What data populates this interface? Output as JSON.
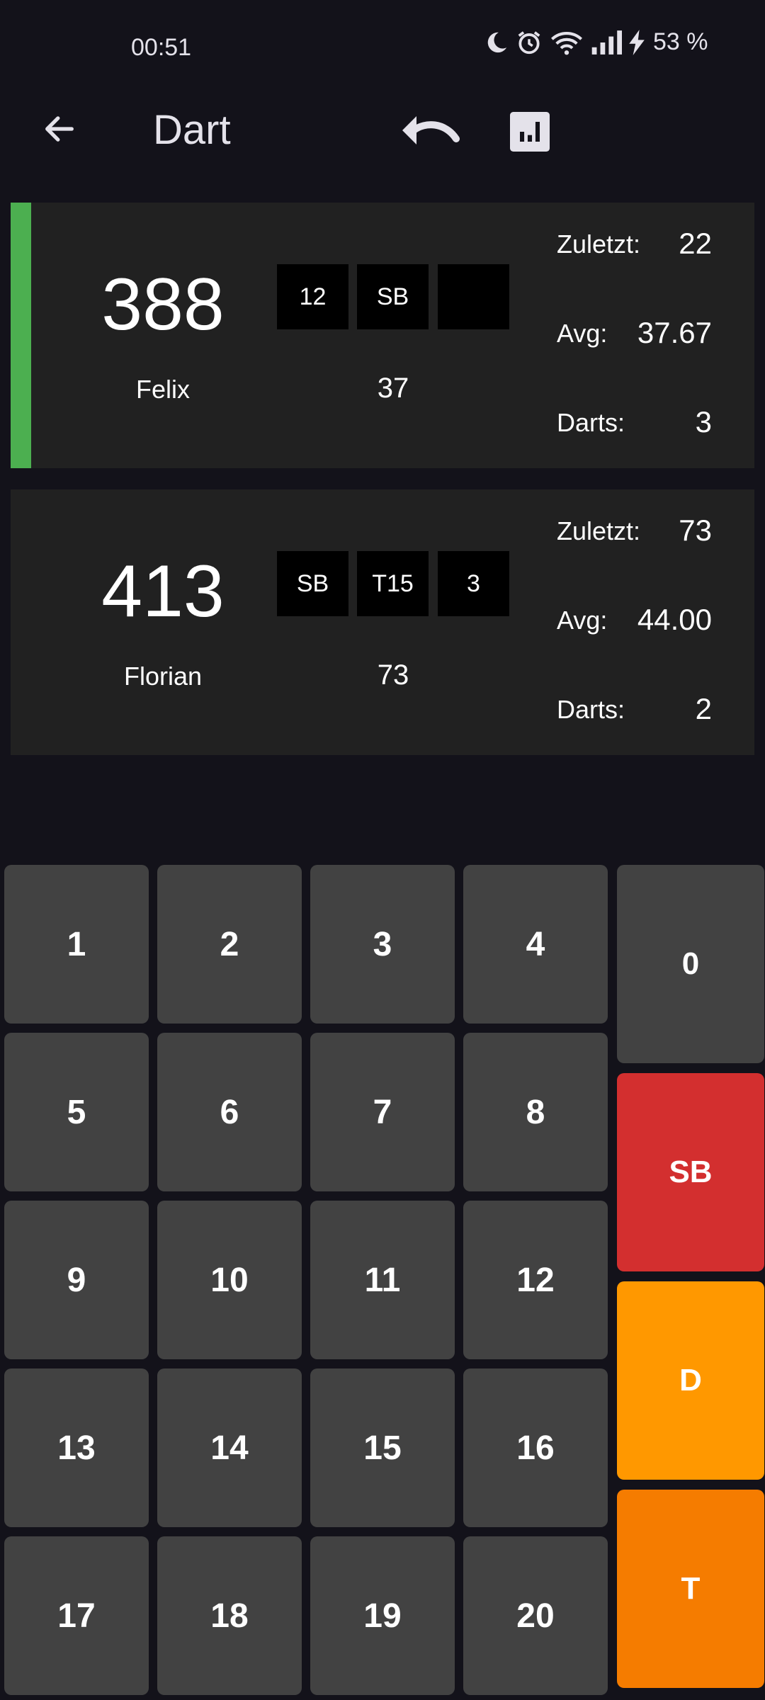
{
  "status_bar": {
    "time": "00:51",
    "battery": "53 %",
    "icons": [
      "moon-icon",
      "alarm-icon",
      "wifi-icon",
      "signal-icon",
      "charging-icon"
    ]
  },
  "app_bar": {
    "title": "Dart",
    "back_icon": "arrow-left-icon",
    "undo_icon": "undo-icon",
    "stats_icon": "bar-chart-icon"
  },
  "players": [
    {
      "name": "Felix",
      "score": "388",
      "throws": [
        "12",
        "SB",
        ""
      ],
      "round_total": "37",
      "active": true,
      "stats": {
        "last_label": "Zuletzt:",
        "last_value": "22",
        "avg_label": "Avg:",
        "avg_value": "37.67",
        "darts_label": "Darts:",
        "darts_value": "3"
      }
    },
    {
      "name": "Florian",
      "score": "413",
      "throws": [
        "SB",
        "T15",
        "3"
      ],
      "round_total": "73",
      "active": false,
      "stats": {
        "last_label": "Zuletzt:",
        "last_value": "73",
        "avg_label": "Avg:",
        "avg_value": "44.00",
        "darts_label": "Darts:",
        "darts_value": "2"
      }
    }
  ],
  "keypad": {
    "numbers": [
      "1",
      "2",
      "3",
      "4",
      "5",
      "6",
      "7",
      "8",
      "9",
      "10",
      "11",
      "12",
      "13",
      "14",
      "15",
      "16",
      "17",
      "18",
      "19",
      "20"
    ],
    "zero": "0",
    "single_bull": "SB",
    "double": "D",
    "triple": "T"
  },
  "colors": {
    "background": "#13121a",
    "card": "#212121",
    "active_indicator": "#4caf50",
    "key": "#424242",
    "single_bull": "#d32f2f",
    "double": "#ff9800",
    "triple": "#f57c00"
  }
}
